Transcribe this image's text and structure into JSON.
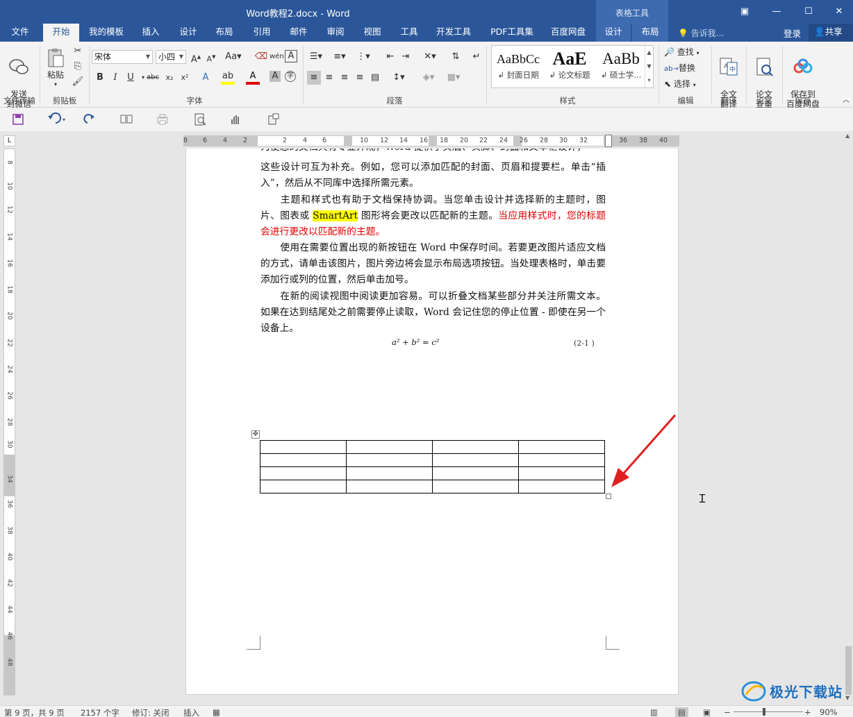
{
  "window": {
    "title": "Word教程2.docx - Word",
    "context_group": "表格工具",
    "restore_glyph": "▣",
    "minimize_glyph": "—",
    "maximize_glyph": "☐",
    "close_glyph": "✕"
  },
  "tabs": [
    {
      "label": "文件"
    },
    {
      "label": "开始"
    },
    {
      "label": "我的模板"
    },
    {
      "label": "插入"
    },
    {
      "label": "设计"
    },
    {
      "label": "布局"
    },
    {
      "label": "引用"
    },
    {
      "label": "邮件"
    },
    {
      "label": "审阅"
    },
    {
      "label": "视图"
    },
    {
      "label": "工具"
    },
    {
      "label": "开发工具"
    },
    {
      "label": "PDF工具集"
    },
    {
      "label": "百度网盘"
    },
    {
      "label": "设计"
    },
    {
      "label": "布局"
    }
  ],
  "tellme_placeholder": "告诉我...",
  "signin_label": "登录",
  "share_label": "共享",
  "ribbon": {
    "send_wechat": "发送\n到微信",
    "paste": "粘贴",
    "font_name": "宋体",
    "font_size": "小四",
    "styles": [
      {
        "preview": "AaBbCc",
        "caption": "↲ 封面日期"
      },
      {
        "preview": "AaE",
        "caption": "↲ 论文标题"
      },
      {
        "preview": "AaBb",
        "caption": "↲ 硕士学..."
      }
    ],
    "find": "查找",
    "replace": "替换",
    "select": "选择",
    "translate_full": "全文\n翻译",
    "paper_check": "论文\n查重",
    "save_baidu": "保存到\n百度网盘",
    "groups": {
      "file_transfer": "文件传输",
      "clipboard": "剪贴板",
      "font": "字体",
      "paragraph": "段落",
      "styles": "样式",
      "editing": "编辑",
      "translate": "翻译",
      "paper": "论文",
      "save": "保存"
    }
  },
  "ruler_h": [
    "8",
    "6",
    "4",
    "2",
    "2",
    "4",
    "6",
    "10",
    "12",
    "14",
    "16",
    "18",
    "20",
    "22",
    "24",
    "26",
    "28",
    "30",
    "32",
    "36",
    "38",
    "40"
  ],
  "ruler_v": [
    "8",
    "10",
    "12",
    "14",
    "16",
    "18",
    "20",
    "22",
    "24",
    "26",
    "28",
    "30",
    "34",
    "36",
    "38",
    "40",
    "42",
    "44",
    "46",
    "48"
  ],
  "document": {
    "line0": "为使您的文档具有专业外观，Word 提供了页眉、页脚、封面和文本框设计，",
    "p1": "这些设计可互为补充。例如，您可以添加匹配的封面、页眉和提要栏。单击“插入”，然后从不同库中选择所需元素。",
    "p2_a": "主题和样式也有助于文档保持协调。当您单击设计并选择新的主题时，图片、图表或 ",
    "p2_hl": "SmartArt",
    "p2_b": " 图形将会更改以匹配新的主题。",
    "p2_red": "当应用样式时，您的标题会进行更改以匹配新的主题。",
    "p3": "使用在需要位置出现的新按钮在 Word 中保存时间。若要更改图片适应文档的方式，请单击该图片，图片旁边将会显示布局选项按钮。当处理表格时，单击要添加行或列的位置，然后单击加号。",
    "p4": "在新的阅读视图中阅读更加容易。可以折叠文档某些部分并关注所需文本。如果在达到结尾处之前需要停止读取，Word 会记住您的停止位置 - 即使在另一个设备上。",
    "equation": "a² + b² = c²",
    "equation_number": "(2-1 )",
    "table": {
      "rows": 4,
      "cols": 4
    }
  },
  "statusbar": {
    "page": "第 9 页，共 9 页",
    "words": "2157 个字",
    "track": "修订: 关闭",
    "insert": "插入",
    "zoom": "90%"
  },
  "watermark": "极光下载站",
  "colors": {
    "accent": "#2b579a",
    "arrow": "#e02020",
    "highlight": "#ffff00",
    "red_text": "#e00000"
  }
}
